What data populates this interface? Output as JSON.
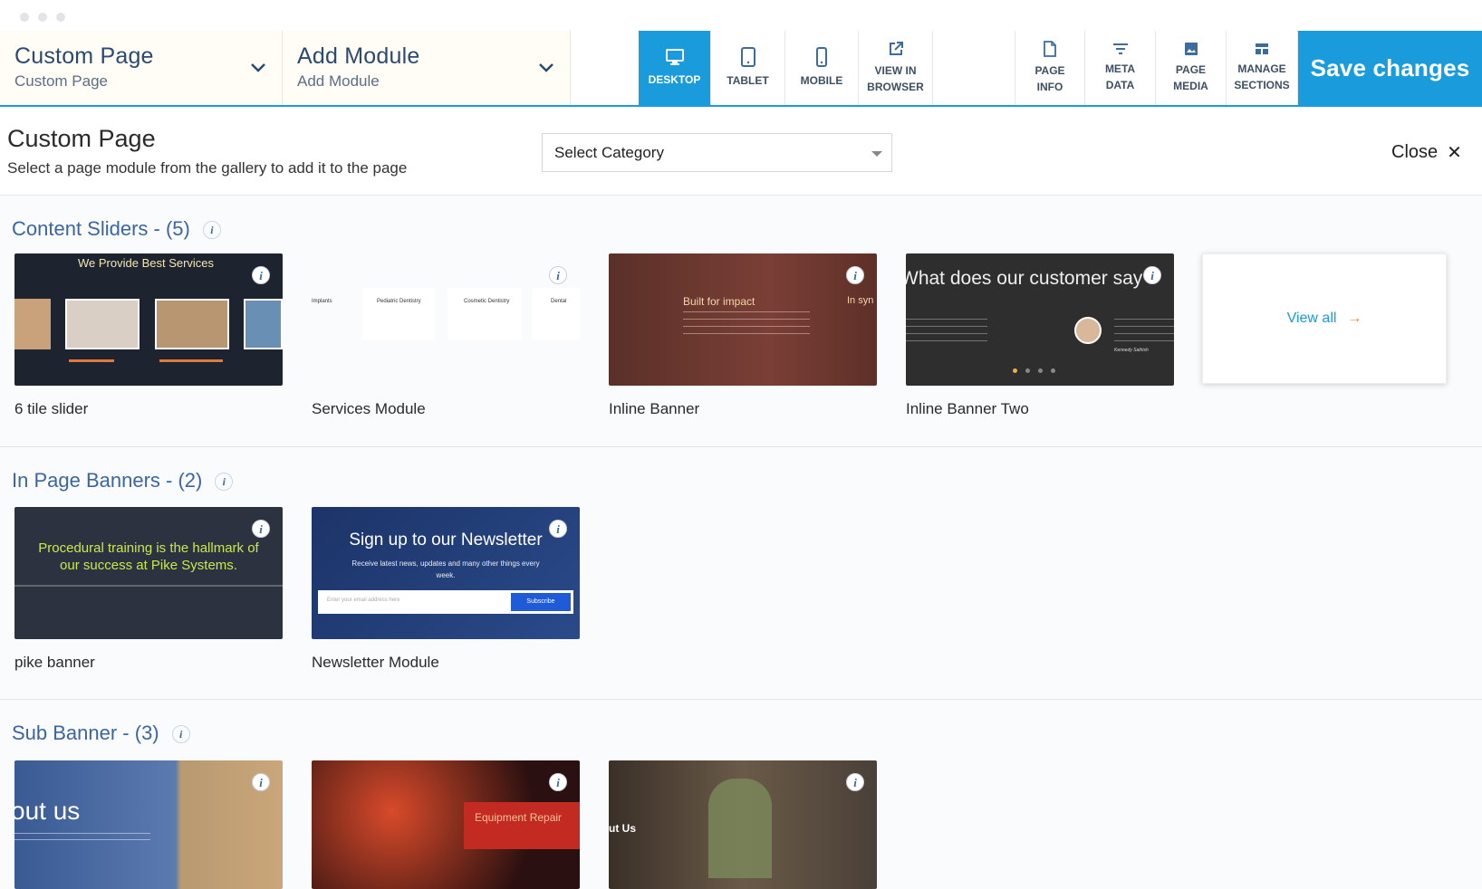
{
  "toolbar": {
    "page_select": {
      "title": "Custom Page",
      "subtitle": "Custom Page"
    },
    "module_select": {
      "title": "Add Module",
      "subtitle": "Add Module"
    },
    "buttons": [
      {
        "label": "DESKTOP",
        "icon": "desktop-icon",
        "active": true
      },
      {
        "label": "TABLET",
        "icon": "tablet-icon"
      },
      {
        "label": "MOBILE",
        "icon": "mobile-icon"
      },
      {
        "label": "VIEW IN\nBROWSER",
        "icon": "external-link-icon"
      },
      {
        "label": "PAGE\nINFO",
        "icon": "file-icon"
      },
      {
        "label": "META\nDATA",
        "icon": "filter-icon"
      },
      {
        "label": "PAGE\nMEDIA",
        "icon": "image-icon"
      },
      {
        "label": "MANAGE\nSECTIONS",
        "icon": "sections-icon"
      }
    ],
    "save_label": "Save changes"
  },
  "header": {
    "title": "Custom Page",
    "subtitle": "Select a page module from the gallery to add it to the page",
    "category_select": "Select Category",
    "close_label": "Close"
  },
  "sections": {
    "content_sliders": {
      "title": "Content Sliders - (5)",
      "cards": [
        {
          "label": "6 tile slider",
          "heading": "We Provide Best Services"
        },
        {
          "label": "Services Module",
          "items": [
            "Implants",
            "Pediatric Dentistry",
            "Cosmetic Dentistry",
            "Dental"
          ]
        },
        {
          "label": "Inline Banner",
          "heading": "Built for impact",
          "side": "In syn"
        },
        {
          "label": "Inline Banner Two",
          "heading": "What does our customer say",
          "person": "Kennedy Sathish"
        }
      ],
      "view_all": "View all"
    },
    "in_page_banners": {
      "title": "In Page Banners - (2)",
      "cards": [
        {
          "label": "pike banner",
          "heading": "Procedural training is the hallmark of our success at Pike Systems."
        },
        {
          "label": "Newsletter Module",
          "heading": "Sign up to our Newsletter",
          "sub": "Receive latest news, updates and many other things every week.",
          "placeholder": "Enter your email address here",
          "button": "Subscribe"
        }
      ]
    },
    "sub_banner": {
      "title": "Sub Banner - (3)",
      "cards": [
        {
          "heading": "out us"
        },
        {
          "heading": "Equipment Repair"
        },
        {
          "heading": "ut Us"
        }
      ]
    }
  },
  "colors": {
    "accent": "#1a9bdc",
    "section_title": "#3b66a0",
    "arrow": "#f08a3c"
  }
}
